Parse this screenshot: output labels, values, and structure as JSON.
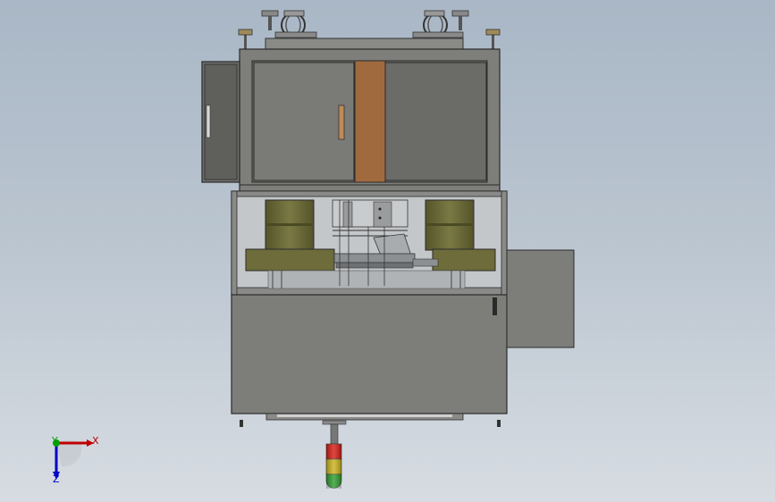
{
  "viewport": {
    "name": "cad-graphics-area",
    "background_top": "#a9b7c6",
    "background_bottom": "#d7dce2"
  },
  "model": {
    "parts": [
      "top-handwheel-left",
      "top-handwheel-right",
      "top-pin-left",
      "top-pin-right",
      "upper-cabinet",
      "side-drawer-left",
      "cabinet-door-left",
      "cabinet-door-right",
      "center-wood-panel",
      "door-handle",
      "middle-frame",
      "roller-left",
      "roller-right",
      "feed-plate",
      "center-mechanism",
      "lower-cabinet",
      "side-box-right",
      "bottom-rail",
      "signal-tower"
    ],
    "colors": {
      "steel": "#7d7d79",
      "steel_dark": "#6a6a67",
      "wood": "#a06a3e",
      "olive": "#6b6a38",
      "signal_red": "#d41a12",
      "signal_yellow": "#c8b01a",
      "signal_green": "#2c9a2c"
    }
  },
  "triad": {
    "x_label": "X",
    "y_label": "Y",
    "z_label": "Z",
    "x_color": "#c00000",
    "y_color": "#00a000",
    "z_color": "#0000c8"
  }
}
